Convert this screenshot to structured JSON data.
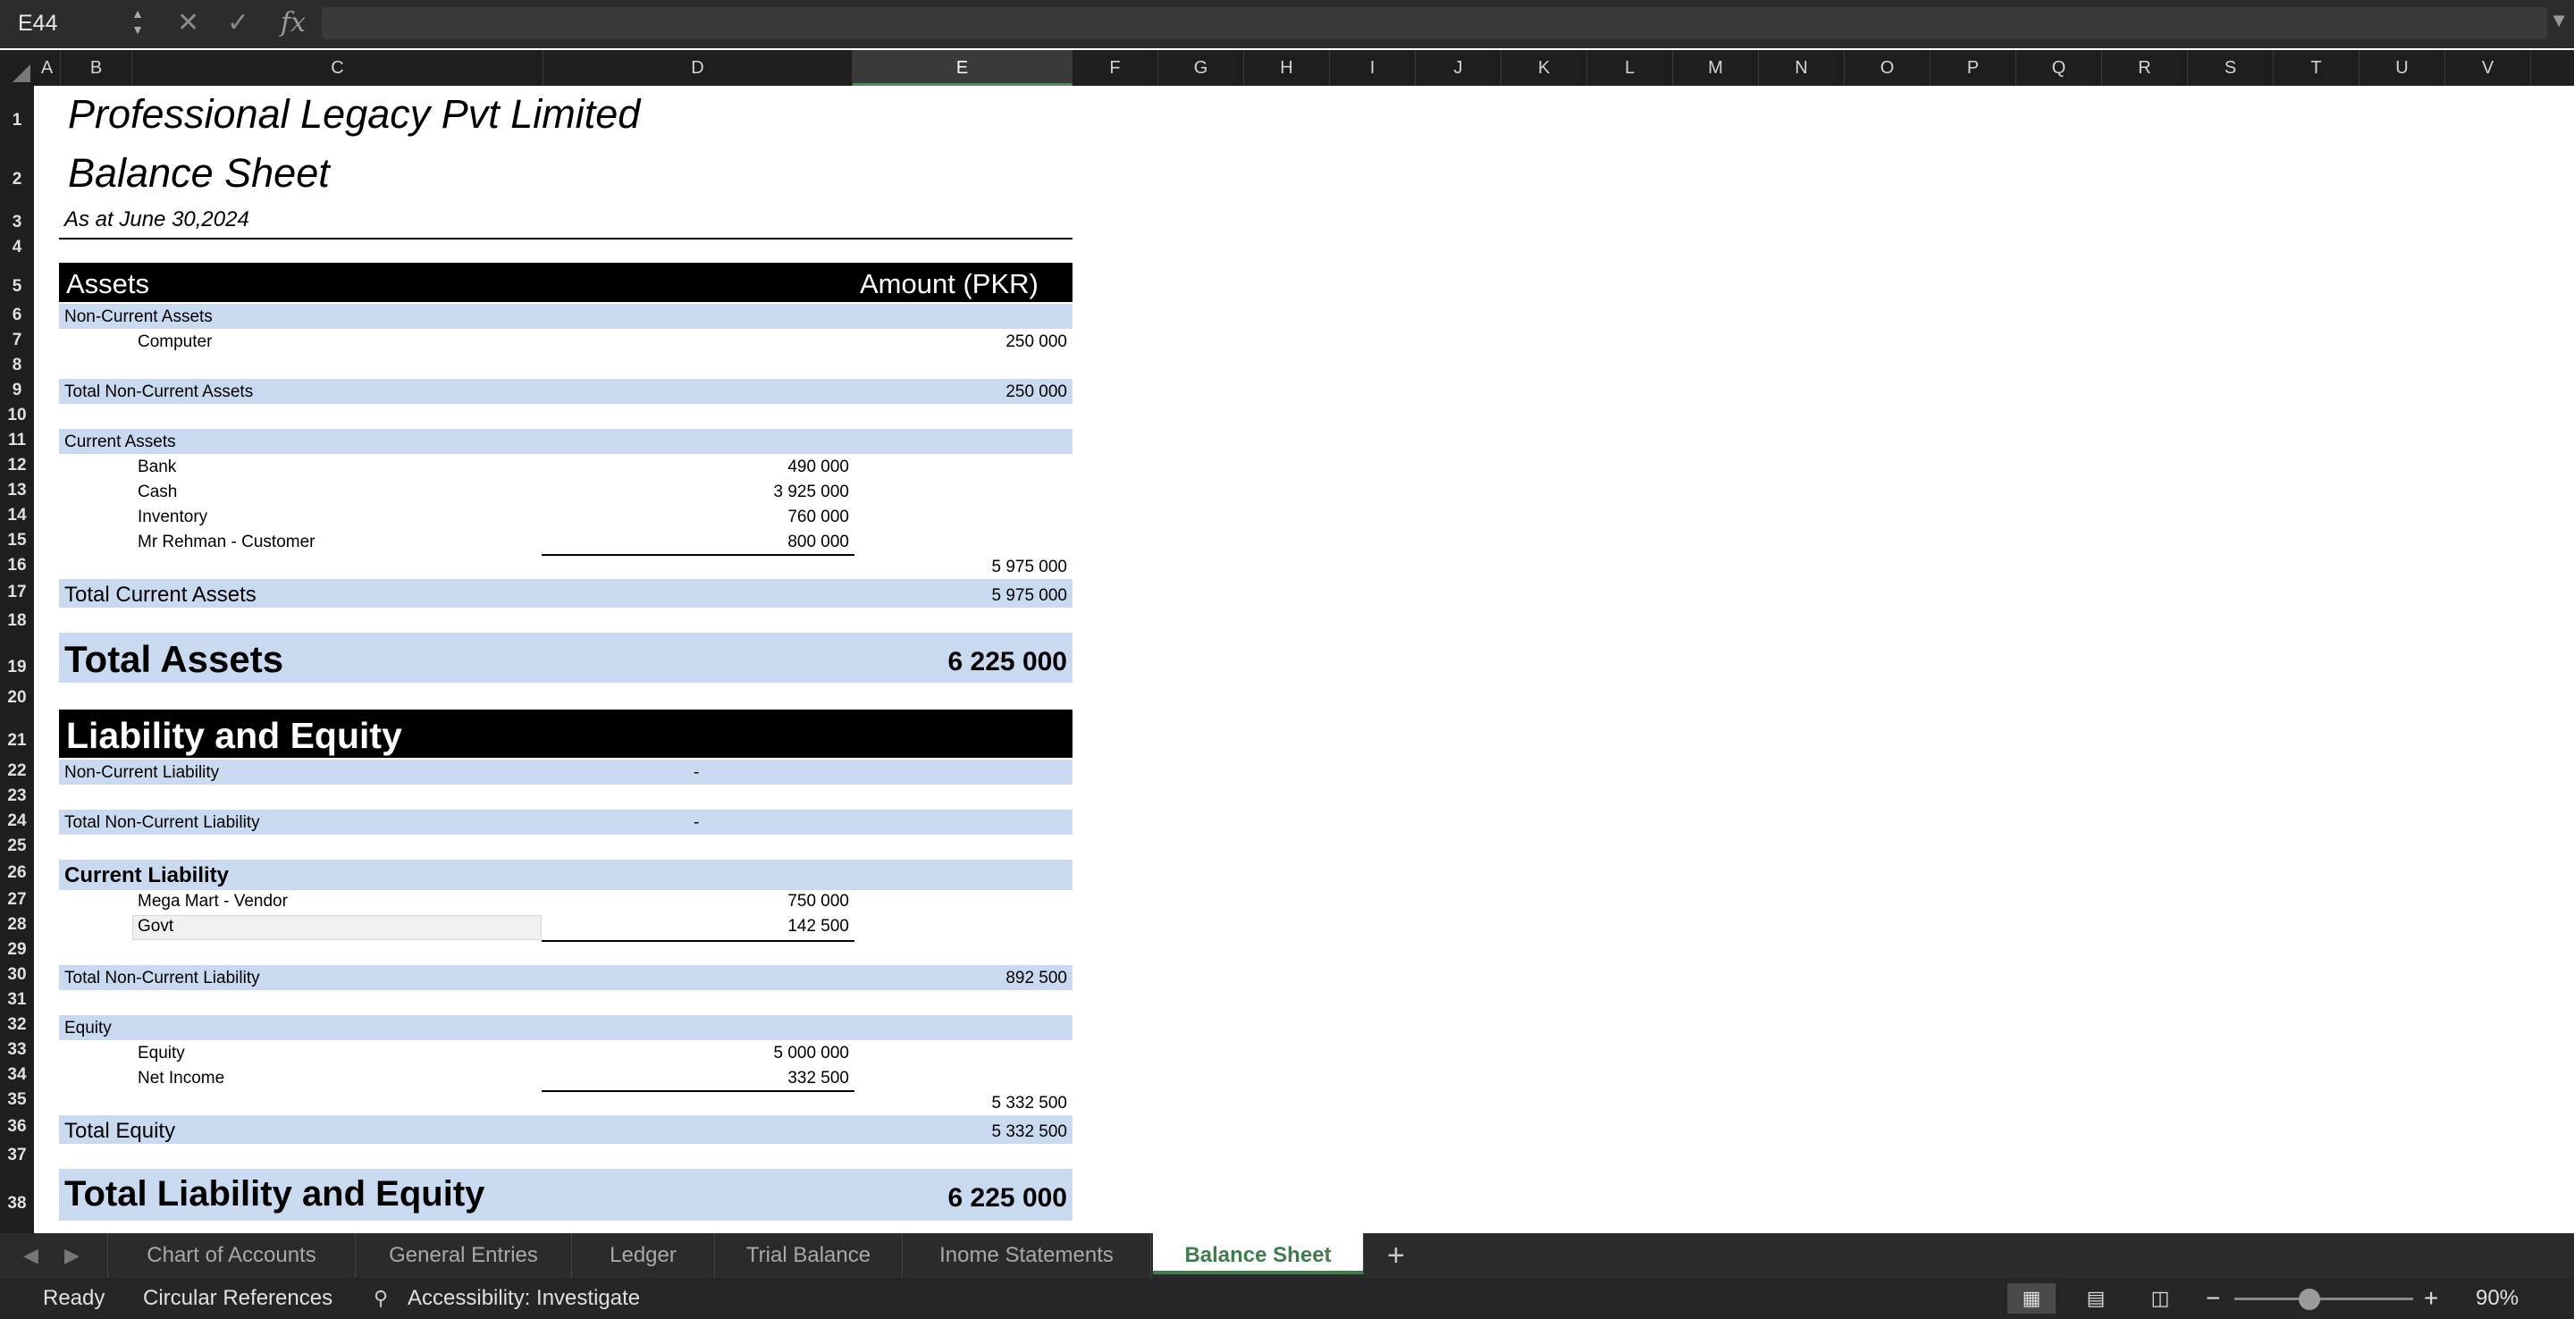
{
  "formula_bar": {
    "name_box": "E44",
    "cancel_icon": "✕",
    "enter_icon": "✓",
    "fx_label": "fx",
    "formula": ""
  },
  "columns": [
    "A",
    "B",
    "C",
    "D",
    "E",
    "F",
    "G",
    "H",
    "I",
    "J",
    "K",
    "L",
    "M",
    "N",
    "O",
    "P",
    "Q",
    "R",
    "S",
    "T",
    "U",
    "V"
  ],
  "selected_column": "E",
  "rows": [
    "1",
    "2",
    "3",
    "4",
    "5",
    "6",
    "7",
    "8",
    "9",
    "10",
    "11",
    "12",
    "13",
    "14",
    "15",
    "16",
    "17",
    "18",
    "19",
    "20",
    "21",
    "22",
    "23",
    "24",
    "25",
    "26",
    "27",
    "28",
    "29",
    "30",
    "31",
    "32",
    "33",
    "34",
    "35",
    "36",
    "37",
    "38"
  ],
  "sheet": {
    "company": "Professional Legacy Pvt Limited",
    "title": "Balance Sheet",
    "date": "As at June 30,2024",
    "assets_header": "Assets",
    "amount_header": "Amount (PKR)",
    "nca_label": "Non-Current Assets",
    "computer_label": "Computer",
    "computer_value": "250 000",
    "total_nca_label": "Total Non-Current Assets",
    "total_nca_value": "250 000",
    "ca_label": "Current Assets",
    "bank_label": "Bank",
    "bank_value": "490 000",
    "cash_label": "Cash",
    "cash_value": "3 925 000",
    "inventory_label": "Inventory",
    "inventory_value": "760 000",
    "customer_label": "Mr Rehman - Customer",
    "customer_value": "800 000",
    "ca_subtotal": "5 975 000",
    "total_ca_label": "Total Current Assets",
    "total_ca_value": "5 975 000",
    "total_assets_label": "Total Assets",
    "total_assets_value": "6 225 000",
    "le_header": "Liability and Equity",
    "ncl_label": "Non-Current Liability",
    "ncl_value": "-",
    "total_ncl_label": "Total Non-Current Liability",
    "total_ncl_value": "-",
    "cl_label": "Current Liability",
    "vendor_label": "Mega Mart - Vendor",
    "vendor_value": "750 000",
    "govt_label": "Govt",
    "govt_value": "142 500",
    "total_cl_label": "Total Non-Current Liability",
    "total_cl_value": "892 500",
    "equity_section_label": "Equity",
    "equity_label": "Equity",
    "equity_value": "5 000 000",
    "net_income_label": "Net Income",
    "net_income_value": "332 500",
    "equity_subtotal": "5 332 500",
    "total_equity_label": "Total Equity",
    "total_equity_value": "5 332 500",
    "total_le_label": "Total Liability and Equity",
    "total_le_value": "6 225 000"
  },
  "tabs": {
    "prev_icon": "◀",
    "next_icon": "▶",
    "items": [
      "Chart of Accounts",
      "General Entries",
      "Ledger",
      "Trial Balance",
      "Inome Statements",
      "Balance Sheet"
    ],
    "active": "Balance Sheet",
    "add_icon": "+"
  },
  "status": {
    "ready": "Ready",
    "circular": "Circular References",
    "accessibility": "Accessibility: Investigate",
    "zoom_minus": "−",
    "zoom_plus": "+",
    "zoom": "90%",
    "zoom_level_percent": 90
  },
  "colors": {
    "band": "#c9d9ef",
    "header_black": "#000000",
    "active_tab_text": "#3f7d4c"
  }
}
